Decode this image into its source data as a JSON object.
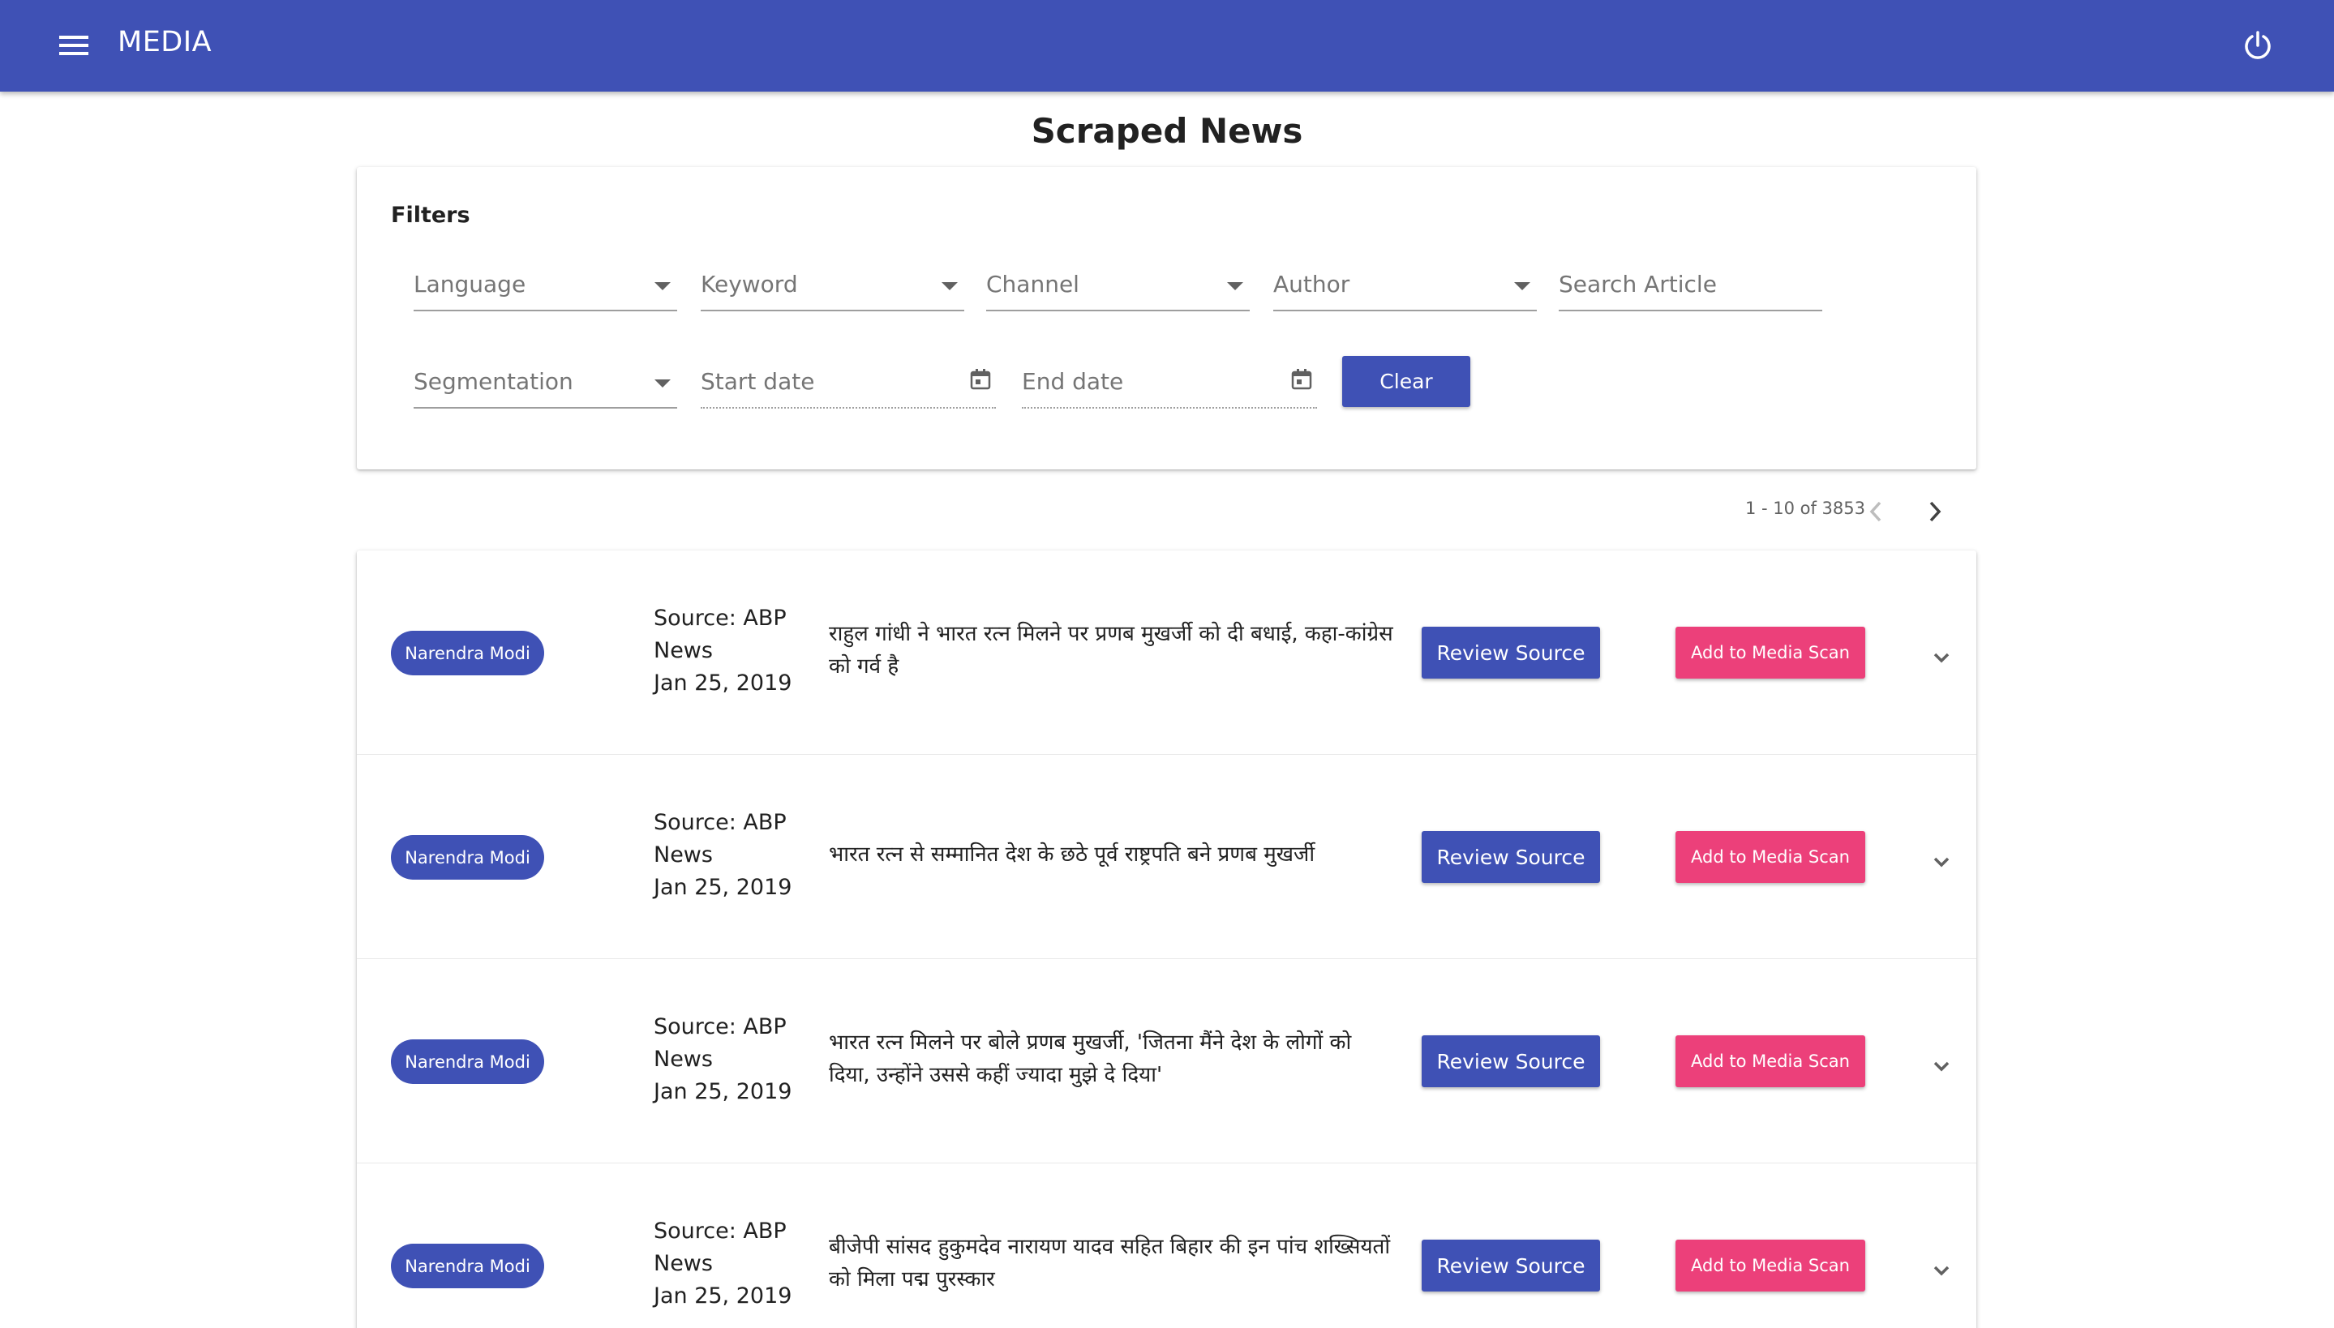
{
  "app": {
    "title": "MEDIA",
    "accent_color": "#3f51b5",
    "secondary_color": "#ec407a",
    "menu_icon": "menu-icon",
    "power_icon": "power-icon"
  },
  "page": {
    "title": "Scraped News"
  },
  "filters": {
    "heading": "Filters",
    "language_label": "Language",
    "keyword_label": "Keyword",
    "channel_label": "Channel",
    "author_label": "Author",
    "search_label": "Search Article",
    "segmentation_label": "Segmentation",
    "start_date_label": "Start date",
    "end_date_label": "End date",
    "clear_label": "Clear"
  },
  "paginator": {
    "range_label": "1 - 10 of 3853"
  },
  "articles": [
    {
      "tag": "Narendra Modi",
      "source": "Source: ABP News",
      "date": "Jan 25, 2019",
      "headline": "राहुल गांधी ने भारत रत्न मिलने पर प्रणब मुखर्जी को दी बधाई, कहा-कांग्रेस को गर्व है",
      "review_label": "Review Source",
      "scan_label": "Add to Media Scan"
    },
    {
      "tag": "Narendra Modi",
      "source": "Source: ABP News",
      "date": "Jan 25, 2019",
      "headline": "भारत रत्न से सम्मानित देश के छठे पूर्व राष्ट्रपति बने प्रणब मुखर्जी",
      "review_label": "Review Source",
      "scan_label": "Add to Media Scan"
    },
    {
      "tag": "Narendra Modi",
      "source": "Source: ABP News",
      "date": "Jan 25, 2019",
      "headline": "भारत रत्न मिलने पर बोले प्रणब मुखर्जी, 'जितना मैंने देश के लोगों को दिया, उन्होंने उससे कहीं ज्यादा मुझे दे दिया'",
      "review_label": "Review Source",
      "scan_label": "Add to Media Scan"
    },
    {
      "tag": "Narendra Modi",
      "source": "Source: ABP News",
      "date": "Jan 25, 2019",
      "headline": "बीजेपी सांसद हुकुमदेव नारायण यादव सहित बिहार की इन पांच शख्सियतों को मिला पद्म पुरस्कार",
      "review_label": "Review Source",
      "scan_label": "Add to Media Scan"
    }
  ]
}
